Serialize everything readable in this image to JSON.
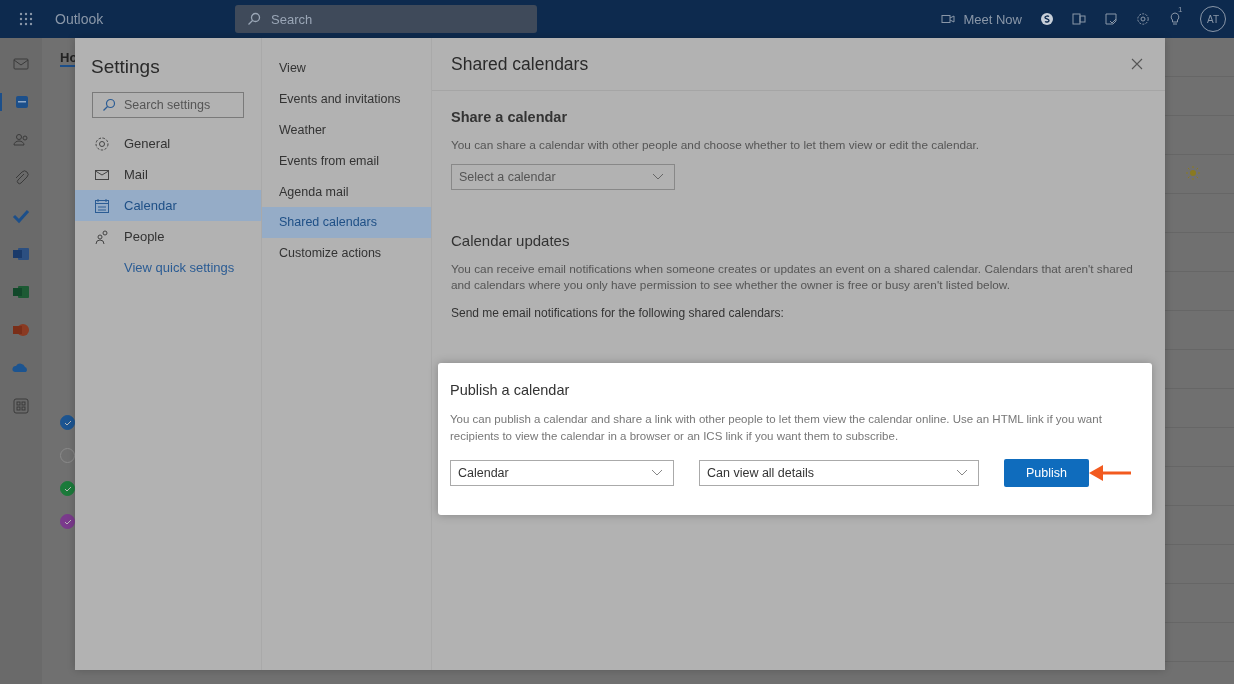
{
  "top_bar": {
    "app_name": "Outlook",
    "search": {
      "placeholder": "Search"
    },
    "meet_now": "Meet Now",
    "notification_count": "1",
    "avatar": "AT"
  },
  "rail": [
    {
      "kind": "mail",
      "selected": false
    },
    {
      "kind": "calendar",
      "selected": true
    },
    {
      "kind": "people",
      "selected": false
    },
    {
      "kind": "files",
      "selected": false
    },
    {
      "kind": "todo",
      "selected": false
    },
    {
      "kind": "word",
      "selected": false
    },
    {
      "kind": "excel",
      "selected": false
    },
    {
      "kind": "powerpoint",
      "selected": false
    },
    {
      "kind": "onedrive",
      "selected": false
    },
    {
      "kind": "apps",
      "selected": false
    }
  ],
  "background": {
    "tab": "Ho",
    "calendars": [
      {
        "color": "#1c5490",
        "checked": true
      },
      {
        "color": "#8a8a8a",
        "checked": false
      },
      {
        "color": "#1b7a3a",
        "checked": true
      },
      {
        "color": "#7a3a8c",
        "checked": true
      }
    ]
  },
  "settings": {
    "title": "Settings",
    "search": {
      "placeholder": "Search settings"
    },
    "categories": [
      {
        "kind": "general",
        "label": "General",
        "selected": false
      },
      {
        "kind": "mail",
        "label": "Mail",
        "selected": false
      },
      {
        "kind": "calendar",
        "label": "Calendar",
        "selected": true
      },
      {
        "kind": "people",
        "label": "People",
        "selected": false
      }
    ],
    "quick_settings_link": "View quick settings",
    "subcategories": [
      {
        "label": "View",
        "selected": false
      },
      {
        "label": "Events and invitations",
        "selected": false
      },
      {
        "label": "Weather",
        "selected": false
      },
      {
        "label": "Events from email",
        "selected": false
      },
      {
        "label": "Agenda mail",
        "selected": false
      },
      {
        "label": "Shared calendars",
        "selected": true
      },
      {
        "label": "Customize actions",
        "selected": false
      }
    ],
    "panel": {
      "title": "Shared calendars",
      "share": {
        "heading": "Share a calendar",
        "description": "You can share a calendar with other people and choose whether to let them view or edit the calendar.",
        "select": {
          "placeholder": "Select a calendar"
        }
      },
      "updates": {
        "heading": "Calendar updates",
        "description": "You can receive email notifications when someone creates or updates an event on a shared calendar. Calendars that aren't shared and calendars where you only have permission to see whether the owner is free or busy aren't listed below.",
        "prompt": "Send me email notifications for the following shared calendars:"
      },
      "publish": {
        "heading": "Publish a calendar",
        "description": "You can publish a calendar and share a link with other people to let them view the calendar online. Use an HTML link if you want recipients to view the calendar in a browser or an ICS link if you want them to subscribe.",
        "calendar": {
          "value": "Calendar"
        },
        "permission": {
          "value": "Can view all details"
        },
        "button": "Publish"
      }
    }
  }
}
